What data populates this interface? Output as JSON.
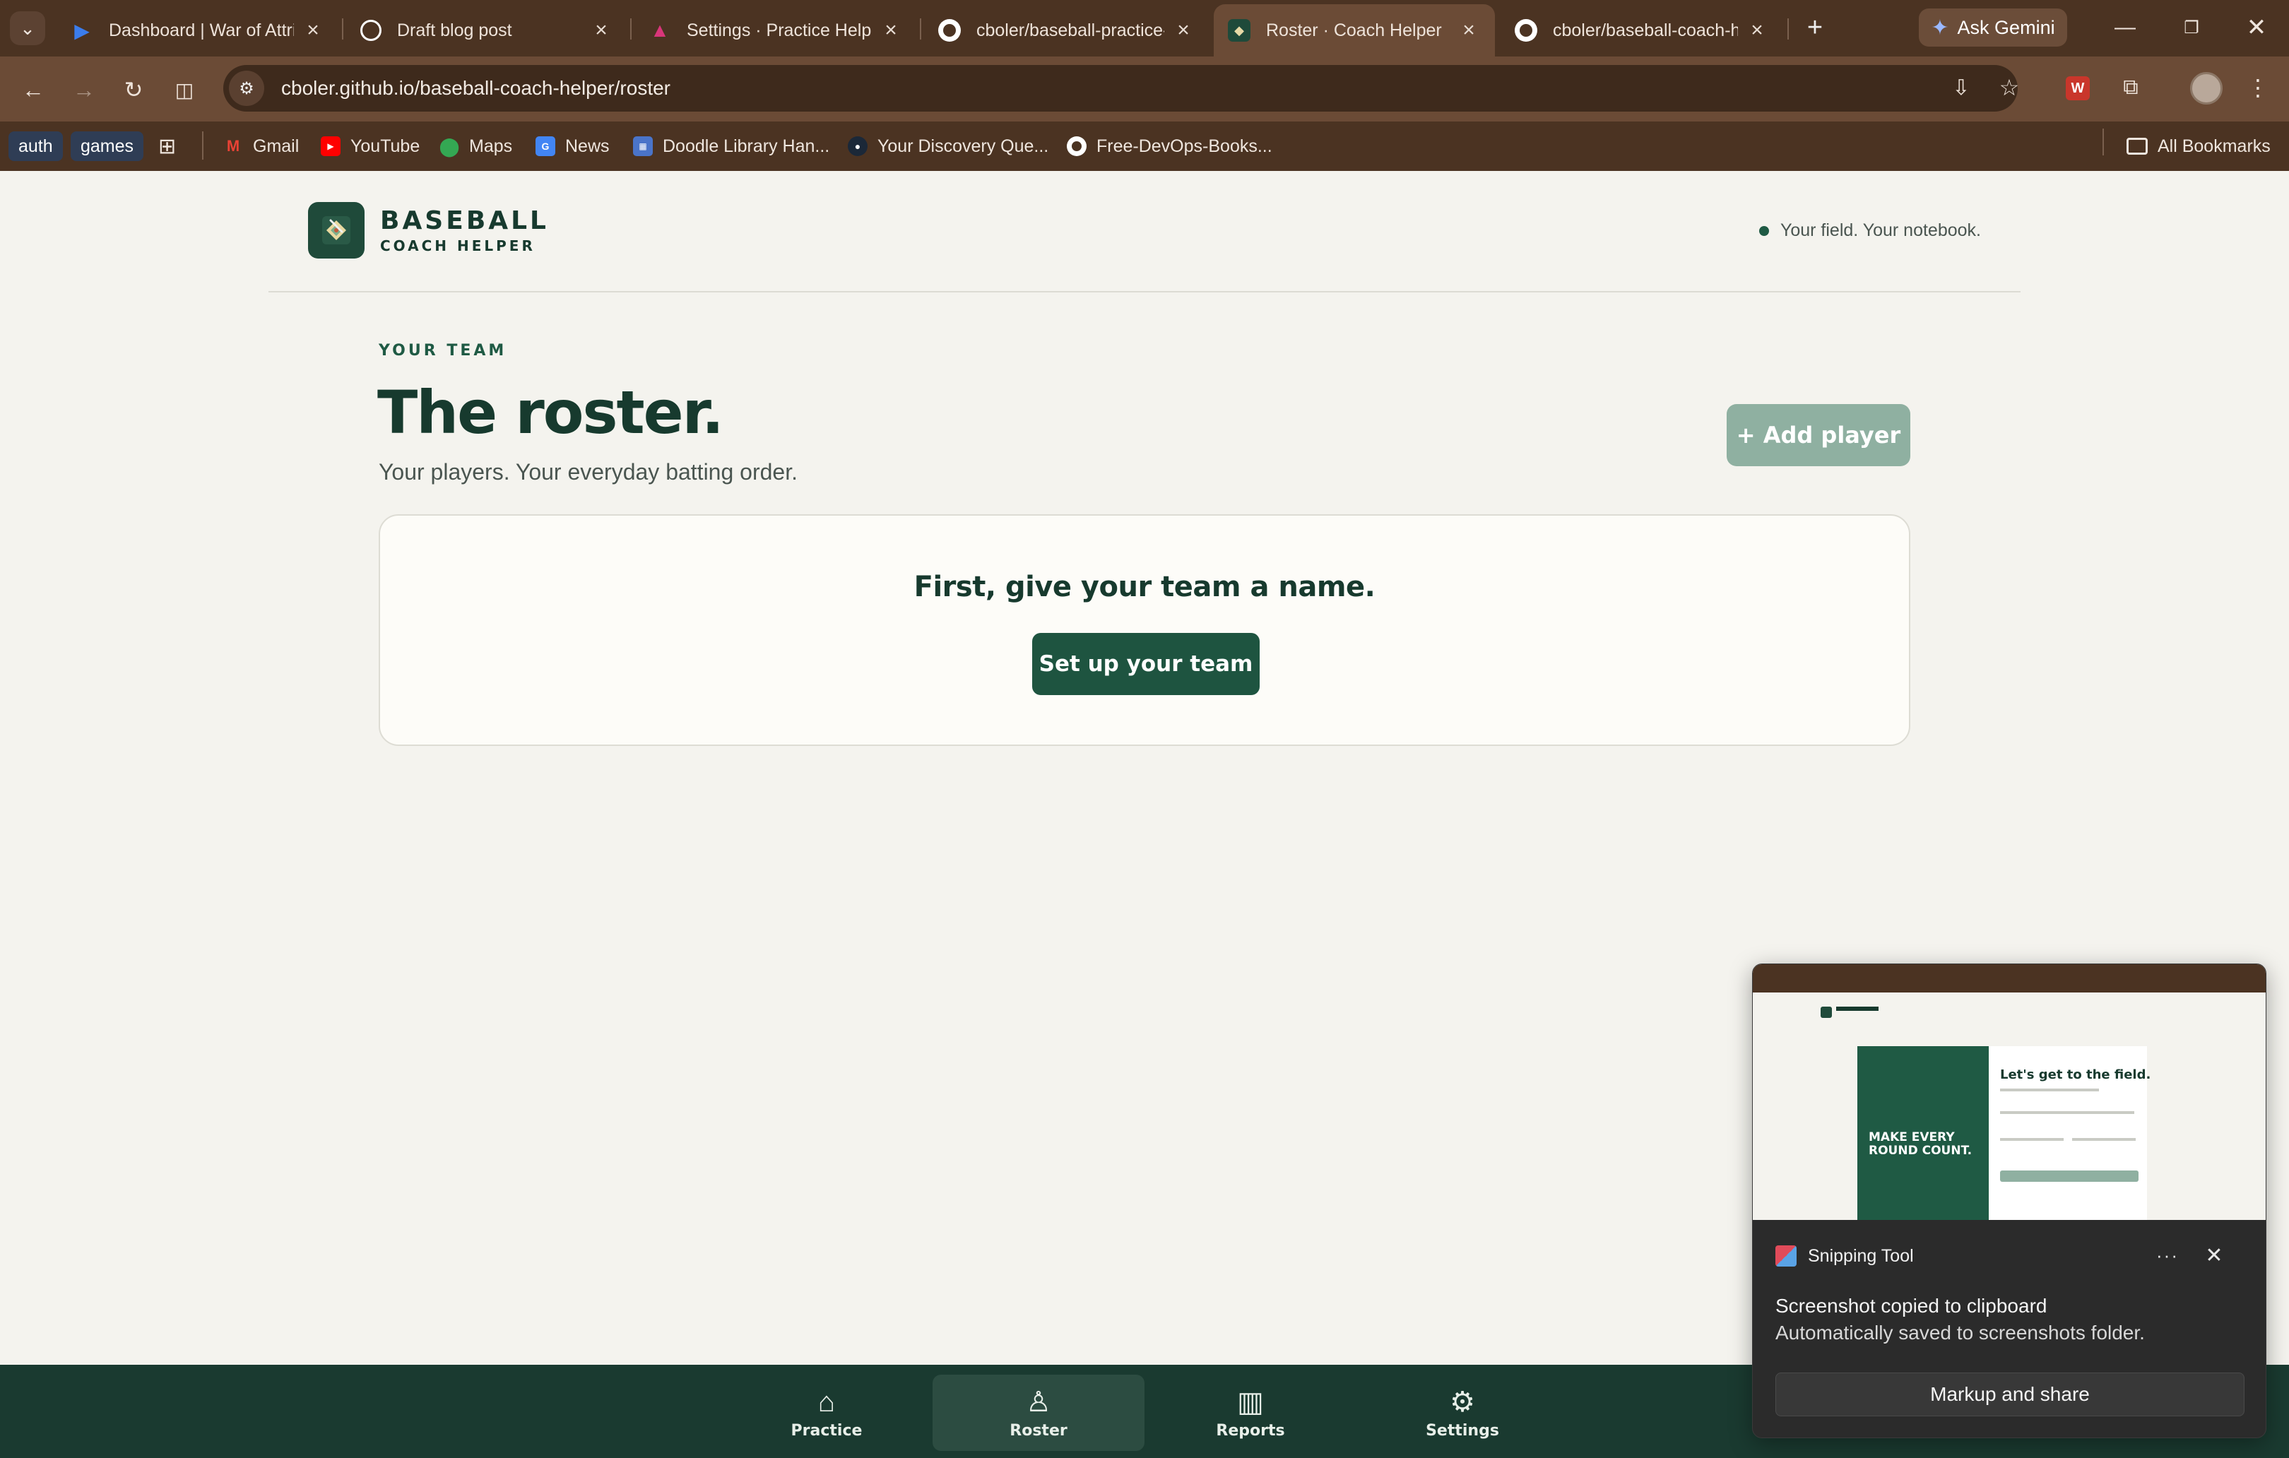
{
  "browser": {
    "tabs": [
      {
        "title": "Dashboard | War of Attrit",
        "favicon": "play-icon",
        "color": "#3b7ded"
      },
      {
        "title": "Draft blog post",
        "favicon": "openai-icon",
        "color": "#ffffff"
      },
      {
        "title": "Settings · Practice Helper",
        "favicon": "triangle-icon",
        "color": "#d9367a"
      },
      {
        "title": "cboler/baseball-practice-",
        "favicon": "github-icon",
        "color": "#ffffff"
      },
      {
        "title": "Roster · Coach Helper",
        "favicon": "baseball-diamond-icon",
        "color": "#1f4a3a",
        "active": true
      },
      {
        "title": "cboler/baseball-coach-h",
        "favicon": "github-icon",
        "color": "#ffffff"
      }
    ],
    "ask_gemini": "Ask Gemini",
    "url": "cboler.github.io/baseball-coach-helper/roster",
    "bookmarks": {
      "chips": [
        "auth",
        "games"
      ],
      "items": [
        "Gmail",
        "YouTube",
        "Maps",
        "News",
        "Doodle Library Han...",
        "Your Discovery Que...",
        "Free-DevOps-Books..."
      ],
      "all_bookmarks": "All Bookmarks"
    }
  },
  "app": {
    "brand_name": "BASEBALL",
    "brand_sub": "COACH HELPER",
    "tagline": "Your field. Your notebook.",
    "eyebrow": "YOUR TEAM",
    "title": "The roster.",
    "subtitle": "Your players. Your everyday batting order.",
    "add_player": "+ Add player",
    "empty_card": {
      "title": "First, give your team a name.",
      "button": "Set up your team"
    },
    "nav": [
      {
        "label": "Practice",
        "icon": "home-icon"
      },
      {
        "label": "Roster",
        "icon": "player-icon",
        "active": true
      },
      {
        "label": "Reports",
        "icon": "columns-icon"
      },
      {
        "label": "Settings",
        "icon": "gear-icon"
      }
    ],
    "colors": {
      "accent": "#1e5440",
      "muted_button": "#8fb0a1",
      "nav_bg": "#1a3a30"
    }
  },
  "toast": {
    "app": "Snipping Tool",
    "line1": "Screenshot copied to clipboard",
    "line2": "Automatically saved to screenshots folder.",
    "button": "Markup and share",
    "thumbnail": {
      "hero": "MAKE EVERY ROUND COUNT.",
      "form_title": "Let's get to the field."
    }
  }
}
